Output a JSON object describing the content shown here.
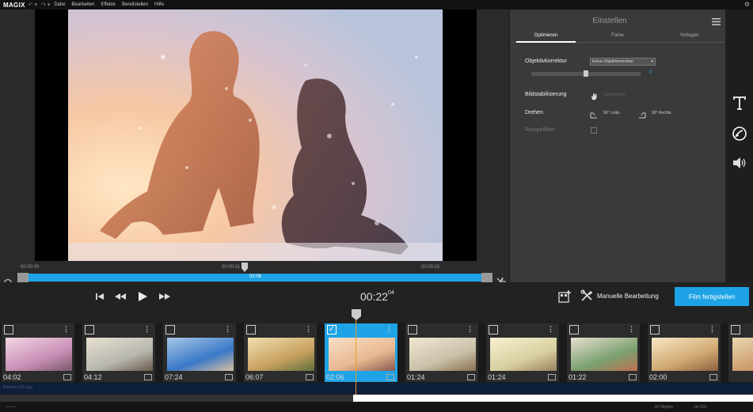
{
  "menubar": {
    "logo": "MAGIX",
    "items": [
      "Datei",
      "Bearbeiten",
      "Effekte",
      "Bereitstellen",
      "Hilfe"
    ]
  },
  "preview": {
    "tc_start": "00:00:00",
    "tc_mid": "00:00:01",
    "tc_end": "00:00:02",
    "scrub_label": "02:06"
  },
  "panel": {
    "title": "Einstellen",
    "tabs": [
      "Optimieren",
      "Farbe",
      "Vorlagen"
    ],
    "lens_label": "Objektivkorrektur",
    "lens_select": "Keine Objektivkorrektur",
    "lens_value": "0",
    "stab_label": "Bildstabilisierung",
    "stab_action": "Durchführen",
    "rotate_label": "Drehen",
    "rotate_left": "90° Links",
    "rotate_right": "90° Rechts",
    "rumble_label": "Rumpelfilter"
  },
  "transport": {
    "timecode_main": "00:22",
    "timecode_frames": "04",
    "manual_label": "Manuelle Bearbeitung",
    "finish_label": "Film fertigstellen"
  },
  "clips": [
    {
      "duration": "04:02",
      "selected": false
    },
    {
      "duration": "04:12",
      "selected": false
    },
    {
      "duration": "07:24",
      "selected": false
    },
    {
      "duration": "06:07",
      "selected": false
    },
    {
      "duration": "02:06",
      "selected": true
    },
    {
      "duration": "01:24",
      "selected": false
    },
    {
      "duration": "01:24",
      "selected": false
    },
    {
      "duration": "01:22",
      "selected": false
    },
    {
      "duration": "02:00",
      "selected": false
    }
  ],
  "audio": {
    "track_name": "Balcony 60s.ogg"
  },
  "status": {
    "objects": "20 Objekte",
    "length": "1m 02s"
  },
  "colors": {
    "accent": "#1ea4e6",
    "playhead": "#e69a2e",
    "panel_bg": "#3a3a3a"
  }
}
